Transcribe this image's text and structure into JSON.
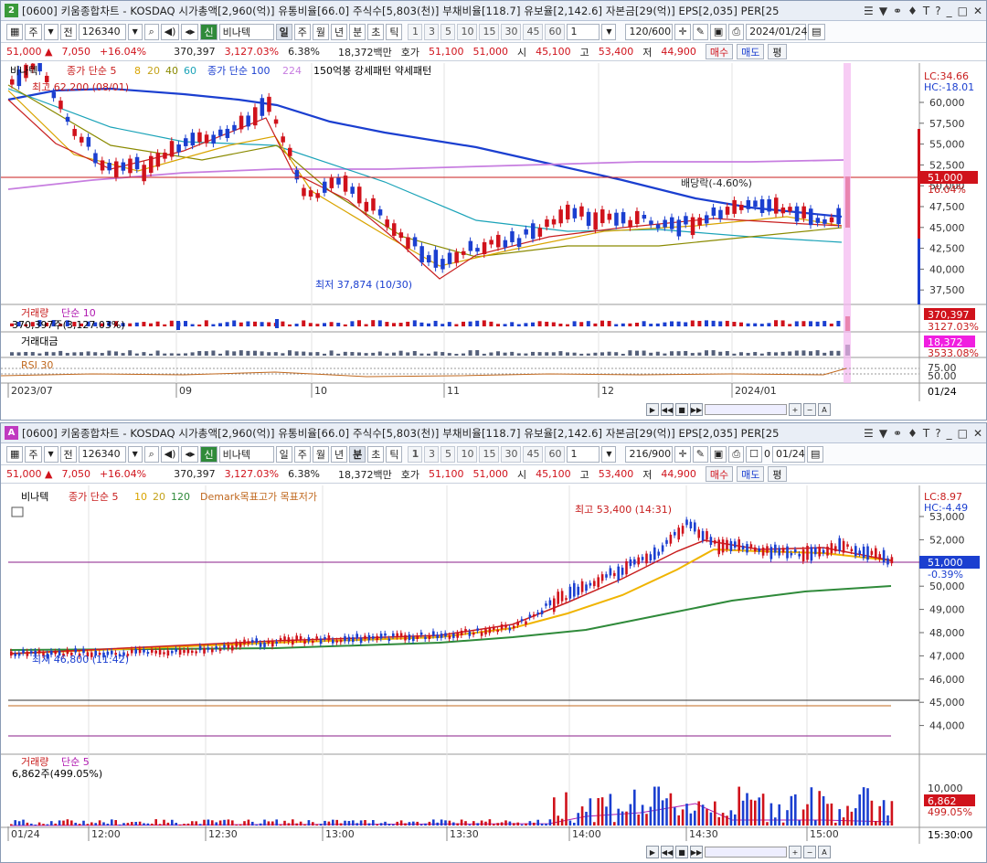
{
  "top": {
    "window_badge": "2",
    "title": "[0600] 키움종합차트 - KOSDAQ 시가총액[2,960(억)] 유통비율[66.0] 주식수[5,803(천)] 부채비율[118.7] 유보율[2,142.6] 자본금[29(억)] EPS[2,035] PER[25",
    "toolbar": {
      "jusik": "주",
      "jeon": "전",
      "code": "126340",
      "name": "비나텍",
      "shin": "신",
      "periods": [
        "일",
        "주",
        "월",
        "년",
        "분",
        "초",
        "틱"
      ],
      "selected_period": "일",
      "minutes": [
        "1",
        "3",
        "5",
        "10",
        "15",
        "30",
        "45",
        "60"
      ],
      "interval": "1",
      "count": "120/600",
      "date": "2024/01/24"
    },
    "quote": {
      "price": "51,000 ▲",
      "change": "7,050",
      "rate": "+16.04%",
      "volume": "370,397",
      "vol_rate": "3,127.03%",
      "turnover": "6.38%",
      "amount": "18,372백만",
      "hoga_label": "호가",
      "ask": "51,100",
      "bid": "51,000",
      "open_label": "시",
      "open": "45,100",
      "high_label": "고",
      "high": "53,400",
      "low_label": "저",
      "low": "44,900",
      "buy": "매수",
      "sell": "매도",
      "avg": "평"
    },
    "legend": {
      "name": "비나텍",
      "ma_label": "종가 단순 5",
      "ma": [
        "8",
        "20",
        "40",
        "60"
      ],
      "ma2": "종가 단순 100",
      "ma3": "224",
      "extra": "150억봉 강세패턴 약세패턴"
    },
    "annotations": {
      "max": "최고 62,200 (08/01)",
      "min": "최저 37,874 (10/30)",
      "dividend": "배당락(-4.60%)"
    },
    "y_ticks": [
      "60,000",
      "57,500",
      "55,000",
      "52,500",
      "50,000",
      "47,500",
      "45,000",
      "42,500",
      "40,000",
      "37,500"
    ],
    "lc": "LC:34.66",
    "hc": "HC:-18.01",
    "price_tag": "51,000",
    "price_pct": "16.04%",
    "volume_panel": {
      "label": "거래량",
      "sub": "단순 10",
      "value": "370,397주(3,127.03%)",
      "tag": "370,397",
      "tag2": "3127.03%"
    },
    "amount_panel": {
      "label": "거래대금",
      "tag": "18,372",
      "tag2": "3533.08%"
    },
    "rsi_panel": {
      "label": "RSI 30",
      "t1": "75.00",
      "t2": "50.00"
    },
    "x_ticks": [
      "2023/07",
      "09",
      "10",
      "11",
      "12",
      "2024/01"
    ],
    "x_end": "01/24"
  },
  "bottom": {
    "window_badge": "A",
    "title": "[0600] 키움종합차트 - KOSDAQ 시가총액[2,960(억)] 유통비율[66.0] 주식수[5,803(천)] 부채비율[118.7] 유보율[2,142.6] 자본금[29(억)] EPS[2,035] PER[25",
    "toolbar": {
      "jusik": "주",
      "jeon": "전",
      "code": "126340",
      "name": "비나텍",
      "shin": "신",
      "periods": [
        "일",
        "주",
        "월",
        "년",
        "분",
        "초",
        "틱"
      ],
      "selected_period": "분",
      "minutes": [
        "1",
        "3",
        "5",
        "10",
        "15",
        "30",
        "45",
        "60"
      ],
      "interval": "1",
      "count": "216/900",
      "check": "0",
      "date": "01/24"
    },
    "quote": {
      "price": "51,000 ▲",
      "change": "7,050",
      "rate": "+16.04%",
      "volume": "370,397",
      "vol_rate": "3,127.03%",
      "turnover": "6.38%",
      "amount": "18,372백만",
      "hoga_label": "호가",
      "ask": "51,100",
      "bid": "51,000",
      "open_label": "시",
      "open": "45,100",
      "high_label": "고",
      "high": "53,400",
      "low_label": "저",
      "low": "44,900",
      "buy": "매수",
      "sell": "매도",
      "avg": "평"
    },
    "legend": {
      "name": "비나텍",
      "ma_label": "종가 단순 5",
      "ma": [
        "10",
        "20",
        "120"
      ],
      "extra": "Demark목표고가 목표저가"
    },
    "annotations": {
      "max": "최고 53,400 (14:31)",
      "min": "최저 46,800 (11:42)"
    },
    "y_ticks": [
      "53,000",
      "52,000",
      "51,000",
      "50,000",
      "49,000",
      "48,000",
      "47,000",
      "46,000",
      "45,000",
      "44,000"
    ],
    "lc": "LC:8.97",
    "hc": "HC:-4.49",
    "price_tag": "51,000",
    "price_pct": "-0.39%",
    "volume_panel": {
      "label": "거래량",
      "sub": "단순 5",
      "value": "6,862주(499.05%)",
      "tag": "6,862",
      "tag2": "499.05%",
      "tick": "10,000"
    },
    "x_ticks": [
      "01/24",
      "12:00",
      "12:30",
      "13:00",
      "13:30",
      "14:00",
      "14:30",
      "15:00"
    ],
    "x_end": "15:30:00"
  }
}
